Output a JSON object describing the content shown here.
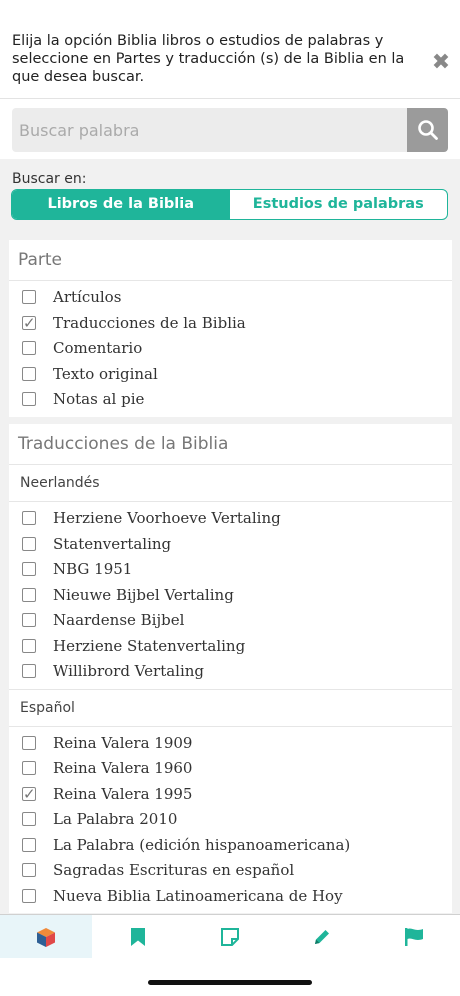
{
  "header": {
    "instruction": "Elija la opción Biblia libros o estudios de palabras y seleccione en Partes y traducción (s) de la Biblia en la que desea buscar.",
    "close_icon": "close-icon"
  },
  "search": {
    "placeholder": "Buscar palabra",
    "value": ""
  },
  "buscar_en": {
    "label": "Buscar en:",
    "options": [
      "Libros de la Biblia",
      "Estudios de palabras"
    ],
    "selected": "Libros de la Biblia"
  },
  "parte": {
    "title": "Parte",
    "items": [
      {
        "label": "Artículos",
        "checked": false
      },
      {
        "label": "Traducciones de la Biblia",
        "checked": true
      },
      {
        "label": "Comentario",
        "checked": false
      },
      {
        "label": "Texto original",
        "checked": false
      },
      {
        "label": "Notas al pie",
        "checked": false
      }
    ]
  },
  "traducciones": {
    "title": "Traducciones de la Biblia",
    "groups": [
      {
        "name": "Neerlandés",
        "items": [
          {
            "label": "Herziene Voorhoeve Vertaling",
            "checked": false
          },
          {
            "label": "Statenvertaling",
            "checked": false
          },
          {
            "label": "NBG 1951",
            "checked": false
          },
          {
            "label": "Nieuwe Bijbel Vertaling",
            "checked": false
          },
          {
            "label": "Naardense Bijbel",
            "checked": false
          },
          {
            "label": "Herziene Statenvertaling",
            "checked": false
          },
          {
            "label": "Willibrord Vertaling",
            "checked": false
          }
        ]
      },
      {
        "name": "Español",
        "items": [
          {
            "label": "Reina Valera 1909",
            "checked": false
          },
          {
            "label": "Reina Valera 1960",
            "checked": false
          },
          {
            "label": "Reina Valera 1995",
            "checked": true
          },
          {
            "label": "La Palabra 2010",
            "checked": false
          },
          {
            "label": "La Palabra (edición hispanoamericana)",
            "checked": false
          },
          {
            "label": "Sagradas Escrituras en español",
            "checked": false
          },
          {
            "label": "Nueva Biblia Latinoamericana de Hoy",
            "checked": false
          }
        ]
      }
    ]
  },
  "tabbar": {
    "tabs": [
      {
        "icon": "cube-icon",
        "active": true
      },
      {
        "icon": "bookmark-icon",
        "active": false
      },
      {
        "icon": "note-icon",
        "active": false
      },
      {
        "icon": "pencil-icon",
        "active": false
      },
      {
        "icon": "flag-icon",
        "active": false
      }
    ]
  },
  "colors": {
    "accent": "#1fb59a",
    "search_button": "#9b9b9b",
    "background": "#f1f1f1"
  }
}
